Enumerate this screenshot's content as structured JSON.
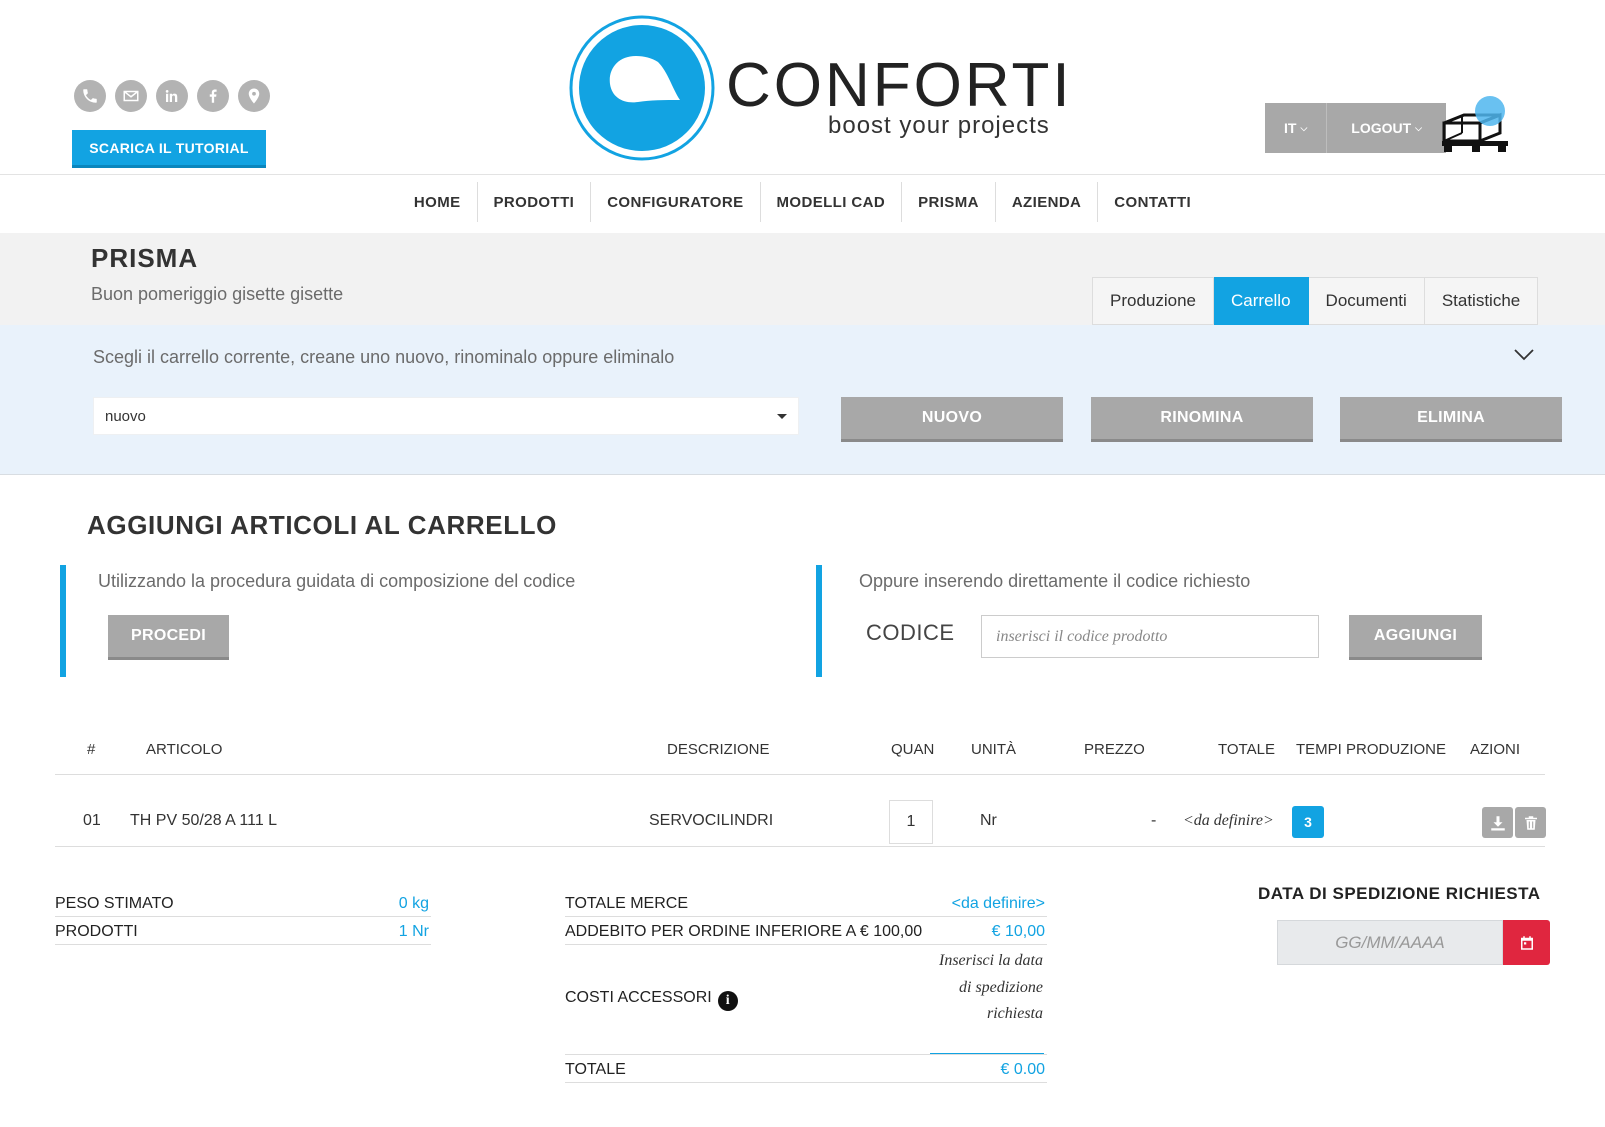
{
  "header": {
    "tutorial_label": "SCARICA IL TUTORIAL",
    "brand_name": "CONFORTI",
    "brand_tagline": "boost your projects",
    "lang_label": "IT",
    "logout_label": "LOGOUT",
    "social_icons": [
      "phone-icon",
      "mail-icon",
      "linkedin-icon",
      "facebook-icon",
      "location-pin-icon"
    ]
  },
  "nav": {
    "items": [
      "HOME",
      "PRODOTTI",
      "CONFIGURATORE",
      "MODELLI CAD",
      "PRISMA",
      "AZIENDA",
      "CONTATTI"
    ]
  },
  "prisma": {
    "title": "PRISMA",
    "greeting": "Buon pomeriggio gisette gisette",
    "tabs": [
      "Produzione",
      "Carrello",
      "Documenti",
      "Statistiche"
    ],
    "active_tab": "Carrello"
  },
  "cart_select": {
    "hint": "Scegli il carrello corrente, creane uno nuovo, rinominalo oppure eliminalo",
    "selected": "nuovo",
    "buttons": {
      "new": "NUOVO",
      "rename": "RINOMINA",
      "delete": "ELIMINA"
    }
  },
  "add_articles": {
    "title": "AGGIUNGI ARTICOLI AL CARRELLO",
    "left_text": "Utilizzando la procedura guidata di composizione del codice",
    "proceed_label": "PROCEDI",
    "right_text": "Oppure inserendo direttamente il codice richiesto",
    "code_label": "CODICE",
    "code_placeholder": "inserisci il codice prodotto",
    "add_label": "AGGIUNGI"
  },
  "table": {
    "headers": {
      "num": "#",
      "article": "ARTICOLO",
      "description": "DESCRIZIONE",
      "qty": "QUAN",
      "unit": "UNITÀ",
      "price": "PREZZO",
      "total": "TOTALE",
      "prod_time": "TEMPI PRODUZIONE",
      "actions": "AZIONI"
    },
    "rows": [
      {
        "num": "01",
        "article": "TH PV 50/28 A 111 L",
        "description": "SERVOCILINDRI",
        "qty": "1",
        "unit": "Nr",
        "price": "-",
        "total": "<da definire>",
        "prod_time": "3"
      }
    ]
  },
  "summary_left": {
    "weight_label": "PESO STIMATO",
    "weight_value": "0 kg",
    "products_label": "PRODOTTI",
    "products_value": "1 Nr"
  },
  "summary_mid": {
    "goods_label": "TOTALE MERCE",
    "goods_value": "<da definire>",
    "surcharge_label": "ADDEBITO PER ORDINE INFERIORE A € 100,00",
    "surcharge_value": "€ 10,00",
    "accessory_label": "COSTI ACCESSORI",
    "accessory_note": "Inserisci la data di spedizione richiesta",
    "total_label": "TOTALE",
    "total_value": "€ 0.00"
  },
  "shipping": {
    "title": "DATA DI SPEDIZIONE RICHIESTA",
    "placeholder": "GG/MM/AAAA"
  },
  "colors": {
    "accent": "#12a3e2",
    "button_gray": "#a8a8a8",
    "danger": "#e0263f"
  }
}
